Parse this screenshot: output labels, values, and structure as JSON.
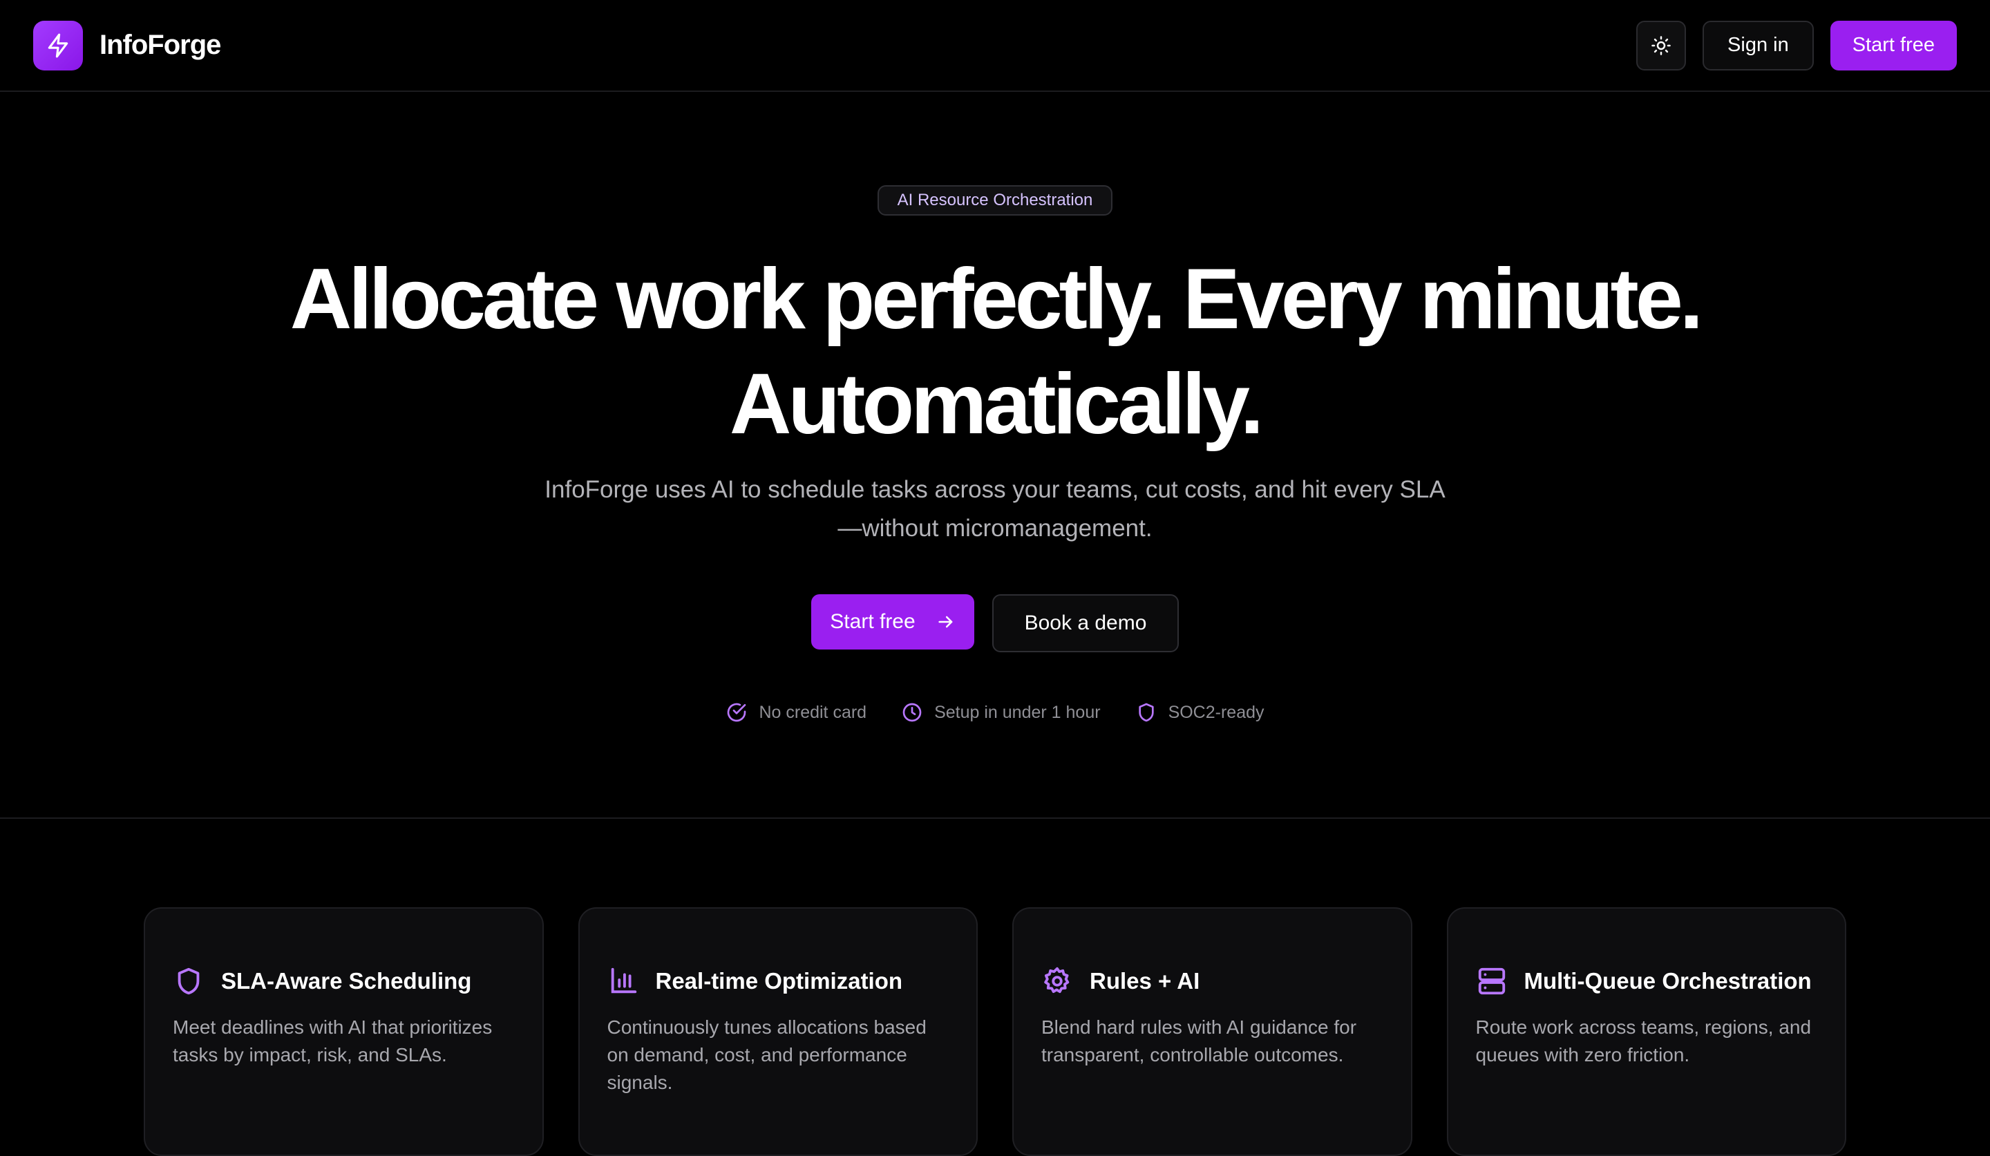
{
  "header": {
    "brand_name": "InfoForge",
    "sign_in_label": "Sign in",
    "start_free_label": "Start free"
  },
  "hero": {
    "badge": "AI Resource Orchestration",
    "title_line1": "Allocate work perfectly. Every minute.",
    "title_line2": "Automatically.",
    "subtitle_line1": "InfoForge uses AI to schedule tasks across your teams, cut costs, and hit every SLA",
    "subtitle_line2": "—without micromanagement.",
    "cta_primary": "Start free",
    "cta_secondary": "Book a demo",
    "trust": [
      {
        "label": "No credit card",
        "icon": "check-circle-icon"
      },
      {
        "label": "Setup in under 1 hour",
        "icon": "clock-icon"
      },
      {
        "label": "SOC2-ready",
        "icon": "shield-icon"
      }
    ]
  },
  "features": [
    {
      "title": "SLA-Aware Scheduling",
      "description": "Meet deadlines with AI that prioritizes tasks by impact, risk, and SLAs.",
      "icon": "shield-icon"
    },
    {
      "title": "Real-time Optimization",
      "description": "Continuously tunes allocations based on demand, cost, and performance signals.",
      "icon": "bar-chart-icon"
    },
    {
      "title": "Rules + AI",
      "description": "Blend hard rules with AI guidance for transparent, controllable outcomes.",
      "icon": "gear-icon"
    },
    {
      "title": "Multi-Queue Orchestration",
      "description": "Route work across teams, regions, and queues with zero friction.",
      "icon": "server-icon"
    }
  ],
  "colors": {
    "accent": "#9a1ff0",
    "icon_accent": "#b877ff",
    "background": "#000000"
  }
}
